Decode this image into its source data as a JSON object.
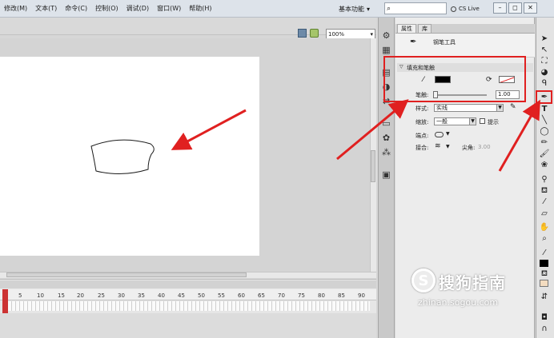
{
  "menu": {
    "items": [
      "修改(M)",
      "文本(T)",
      "命令(C)",
      "控制(O)",
      "调试(D)",
      "窗口(W)",
      "帮助(H)"
    ]
  },
  "topbar": {
    "workspace": "基本功能",
    "workspace_arrow": "▾",
    "search_icon": "⌕",
    "cs_live": "CS Live",
    "window_buttons": [
      "–",
      "◻",
      "✕"
    ]
  },
  "stage": {
    "zoom": "100%",
    "zoom_arrow": "▾"
  },
  "timeline": {
    "ticks": [
      "5",
      "10",
      "15",
      "20",
      "25",
      "30",
      "35",
      "40",
      "45",
      "50",
      "55",
      "60",
      "65",
      "70",
      "75",
      "80",
      "85",
      "90"
    ]
  },
  "panel": {
    "tabs": [
      "属性",
      "库"
    ],
    "tool_name": "钢笔工具",
    "section_fill_stroke": "填充和笔触",
    "section_arrow": "▽",
    "stroke_label": "笔触:",
    "stroke_value": "1.00",
    "style_label": "样式:",
    "style_value": "实线",
    "scale_label": "缩放:",
    "scale_value": "一般",
    "hint_label": "提示",
    "cap_label": "端点:",
    "join_label": "接合:",
    "miter_label": "尖角:",
    "miter_value": "3.00",
    "colors": {
      "stroke_swatch": "#000000",
      "accent_red": "#e02020"
    }
  },
  "watermark": {
    "title": "搜狗指南",
    "url": "zhinan.sogou.com",
    "logo_letter": "S"
  },
  "icons": {
    "dock": [
      "gear-icon",
      "grid-icon",
      "align-icon",
      "color-icon",
      "transform-icon",
      "layers-icon",
      "swatch-icon",
      "motion-icon",
      "components-icon",
      "project-icon"
    ],
    "tools": [
      "selection-icon",
      "subselection-icon",
      "free-transform-icon",
      "3d-rotation-icon",
      "lasso-icon",
      "pen-icon",
      "text-icon",
      "line-icon",
      "oval-icon",
      "pencil-icon",
      "brush-icon",
      "deco-icon",
      "bone-icon",
      "paint-bucket-icon",
      "eyedropper-icon",
      "eraser-icon",
      "hand-icon",
      "zoom-icon"
    ]
  }
}
